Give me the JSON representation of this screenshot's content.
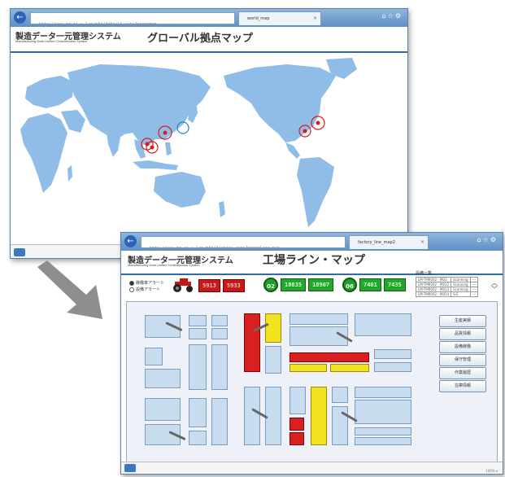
{
  "window1": {
    "address": "http://www-ma-ri-s.lan/mfg/default.aspx?page=map",
    "tab_label": "world_map",
    "brand_jp": "製造データ一元管理システム",
    "brand_en": "Manufacturing Data Unified Centralization System",
    "page_title": "グローバル拠点マップ",
    "map_water_color": "#ffffff",
    "map_land_color": "#8fbde8",
    "marker_color": "#d81b1b"
  },
  "window2": {
    "address": "http://www-ma-ri-s.lan/mfg/factory.aspx?page=line_map",
    "tab_label": "factory_line_map2",
    "brand_jp": "製造データ一元管理システム",
    "brand_en": "Manufacturing Data Unified Centralization System",
    "page_title": "工場ライン・マップ",
    "radio_1": "稼働率アラート",
    "radio_2": "設備アラート",
    "counters": [
      {
        "badge": "",
        "a": "5913",
        "b": "5933",
        "kind": "red"
      },
      {
        "badge": "02",
        "a": "18835",
        "b": "18907",
        "kind": "green"
      },
      {
        "badge": "06",
        "a": "7401",
        "b": "7435",
        "kind": "green"
      }
    ],
    "equipment_list_title": "設備一覧",
    "equipment_rows": [
      [
        "LM-TMR002 - M01",
        "Scanning",
        "---"
      ],
      [
        "LM-TMR002 - M012",
        "Scanning",
        "---"
      ],
      [
        "LM-TMR002 - M013",
        "Scanning",
        "---"
      ],
      [
        "LM-TMR002 - M014",
        "S-E",
        "---"
      ]
    ],
    "side_buttons": [
      "生産実績",
      "品質情報",
      "設備稼働",
      "保守管理",
      "作業履歴",
      "在庫情報"
    ],
    "status_text": "100% ▾"
  }
}
